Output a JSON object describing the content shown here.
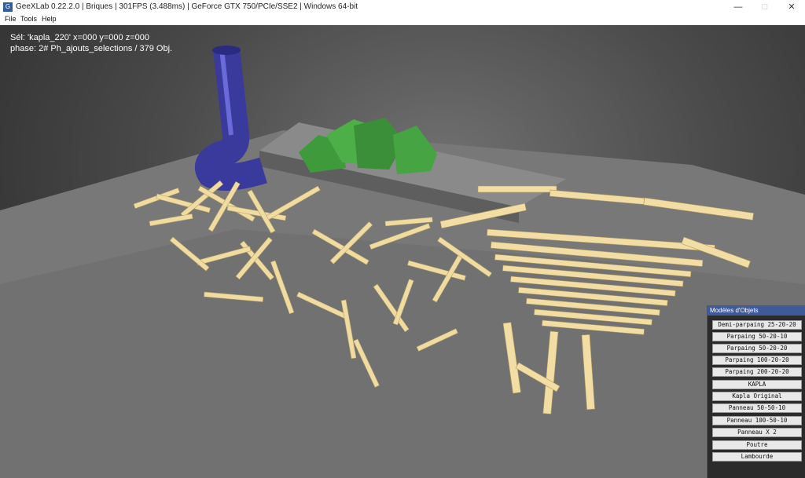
{
  "window": {
    "title": "GeeXLab 0.22.2.0 | Briques | 301FPS (3.488ms) | GeForce GTX 750/PCIe/SSE2 | Windows 64-bit",
    "app_icon": "geexlab-icon"
  },
  "menu": {
    "file": "File",
    "tools": "Tools",
    "help": "Help"
  },
  "hud": {
    "selection": "Sél:  'kapla_220' x=000 y=000 z=000",
    "phase": "phase:  2# Ph_ajouts_selections / 379 Obj."
  },
  "panel": {
    "title": "Modèles d'Objets",
    "buttons": [
      "Demi-parpaing 25-20-20",
      "Parpaing 50-20-10",
      "Parpaing 50-20-20",
      "Parpaing 100-20-20",
      "Parpaing 200-20-20",
      "KAPLA",
      "Kapla Original",
      "Panneau 50-50-10",
      "Panneau 100-50-10",
      "Panneau X 2",
      "Poutre",
      "Lambourde"
    ]
  }
}
